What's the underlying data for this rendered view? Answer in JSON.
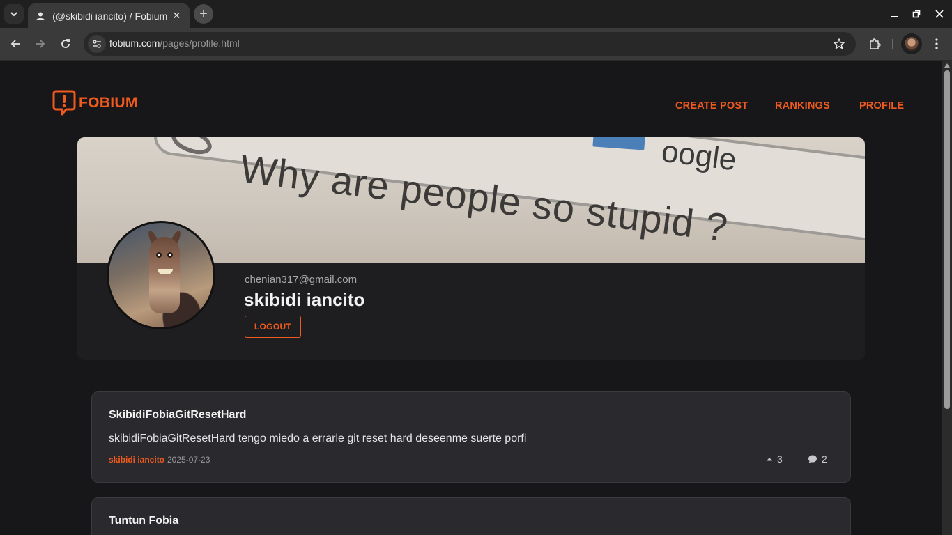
{
  "browser": {
    "tab_title": "(@skibidi iancito) / Fobium",
    "url_host": "fobium.com",
    "url_path": "/pages/profile.html"
  },
  "header": {
    "logo_text": "FOBIUM",
    "nav": [
      {
        "label": "CREATE POST"
      },
      {
        "label": "RANKINGS"
      },
      {
        "label": "PROFILE"
      }
    ]
  },
  "profile": {
    "banner_text": "Why are people so stupid ?",
    "banner_brand": "oogle",
    "email": "chenian317@gmail.com",
    "username": "skibidi iancito",
    "logout_label": "LOGOUT"
  },
  "posts": [
    {
      "title": "SkibidiFobiaGitResetHard",
      "body": "skibidiFobiaGitResetHard tengo miedo a errarle git reset hard deseenme suerte porfi",
      "author": "skibidi iancito",
      "date": "2025-07-23",
      "votes": "3",
      "comments": "2"
    },
    {
      "title": "Tuntun Fobia"
    }
  ],
  "colors": {
    "accent": "#ef5a1f",
    "background": "#171719",
    "card": "#2a2a2e"
  }
}
